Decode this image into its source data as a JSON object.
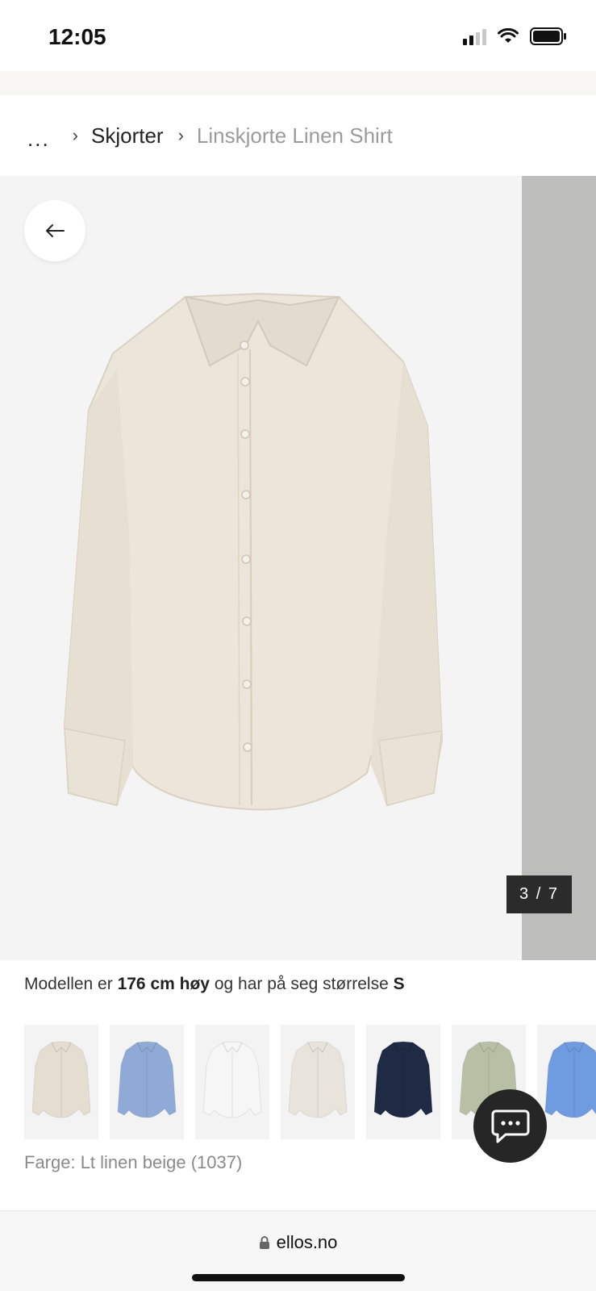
{
  "status_bar": {
    "time": "12:05"
  },
  "breadcrumb": {
    "ellipsis": "...",
    "category": "Skjorter",
    "current": "Linskjorte Linen Shirt"
  },
  "gallery": {
    "counter": "3 / 7",
    "current_index": 3,
    "total": 7
  },
  "model_info": {
    "prefix": "Modellen er",
    "height": "176 cm høy",
    "middle": "og har på seg størrelse",
    "size": "S"
  },
  "swatches": [
    {
      "name": "swatch-lt-linen-beige",
      "color": "#e4ddd0"
    },
    {
      "name": "swatch-blue-stripe",
      "color": "#8faad6"
    },
    {
      "name": "swatch-white",
      "color": "#f6f6f6"
    },
    {
      "name": "swatch-beige-stripe",
      "color": "#e8e4dc"
    },
    {
      "name": "swatch-navy",
      "color": "#1f2a44"
    },
    {
      "name": "swatch-sage",
      "color": "#b7c0a4"
    },
    {
      "name": "swatch-light-blue",
      "color": "#6f9be0"
    }
  ],
  "colour_label": "Farge: Lt linen beige (1037)",
  "browser": {
    "url": "ellos.no"
  },
  "icons": {
    "back": "arrow-left-icon",
    "chat": "chat-bubble-icon",
    "lock": "lock-icon"
  },
  "colors": {
    "product": "#ebe5da",
    "dark_ui": "#262626"
  }
}
